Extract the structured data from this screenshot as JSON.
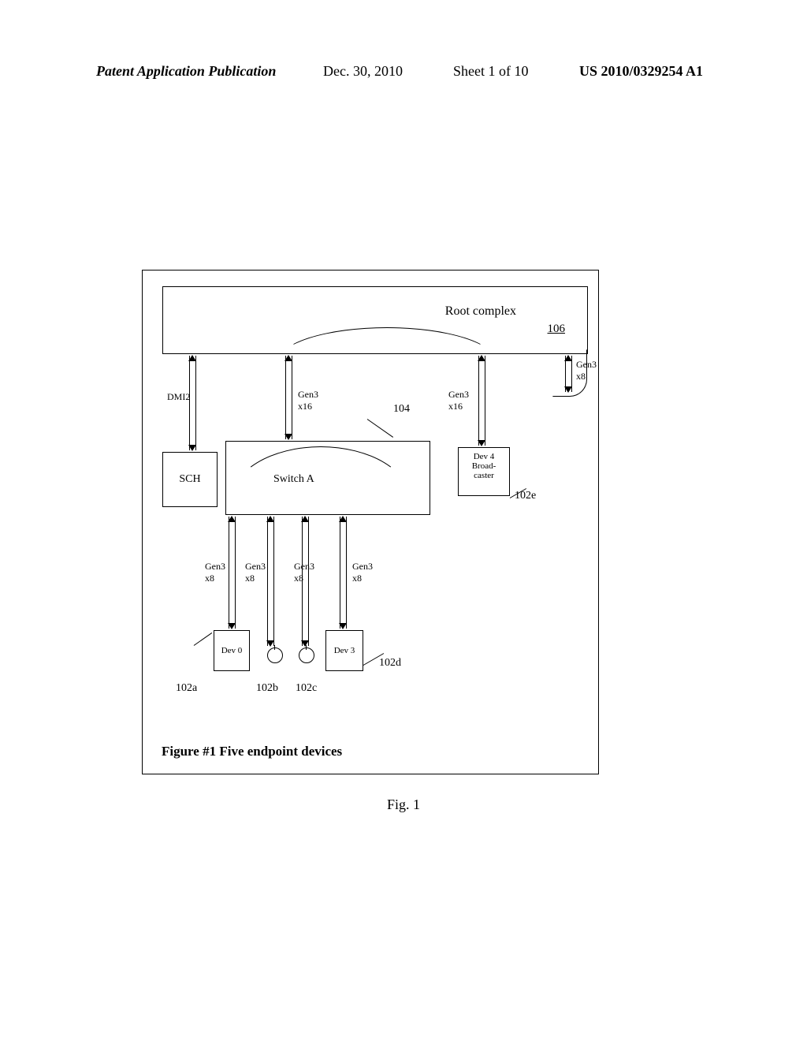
{
  "header": {
    "left": "Patent Application Publication",
    "date": "Dec. 30, 2010",
    "sheet": "Sheet 1 of 10",
    "pubnum": "US 2010/0329254 A1"
  },
  "diagram": {
    "root_label": "Root complex",
    "root_ref": "106",
    "sch_label": "SCH",
    "switchA_label": "Switch A",
    "switchA_ref": "104",
    "dev4_label": "Dev 4\nBroad-\ncaster",
    "dev4_ref": "102e",
    "dev0_label": "Dev 0",
    "dev0_ref": "102a",
    "dev3_label": "Dev 3",
    "dev3_ref": "102d",
    "circle_b_ref": "102b",
    "circle_c_ref": "102c",
    "buses": {
      "dmi": "DMI2",
      "gen3x16": "Gen3\nx16",
      "gen3x8": "Gen3\nx8"
    },
    "inner_caption": "Figure #1 Five endpoint devices"
  },
  "caption": "Fig. 1"
}
